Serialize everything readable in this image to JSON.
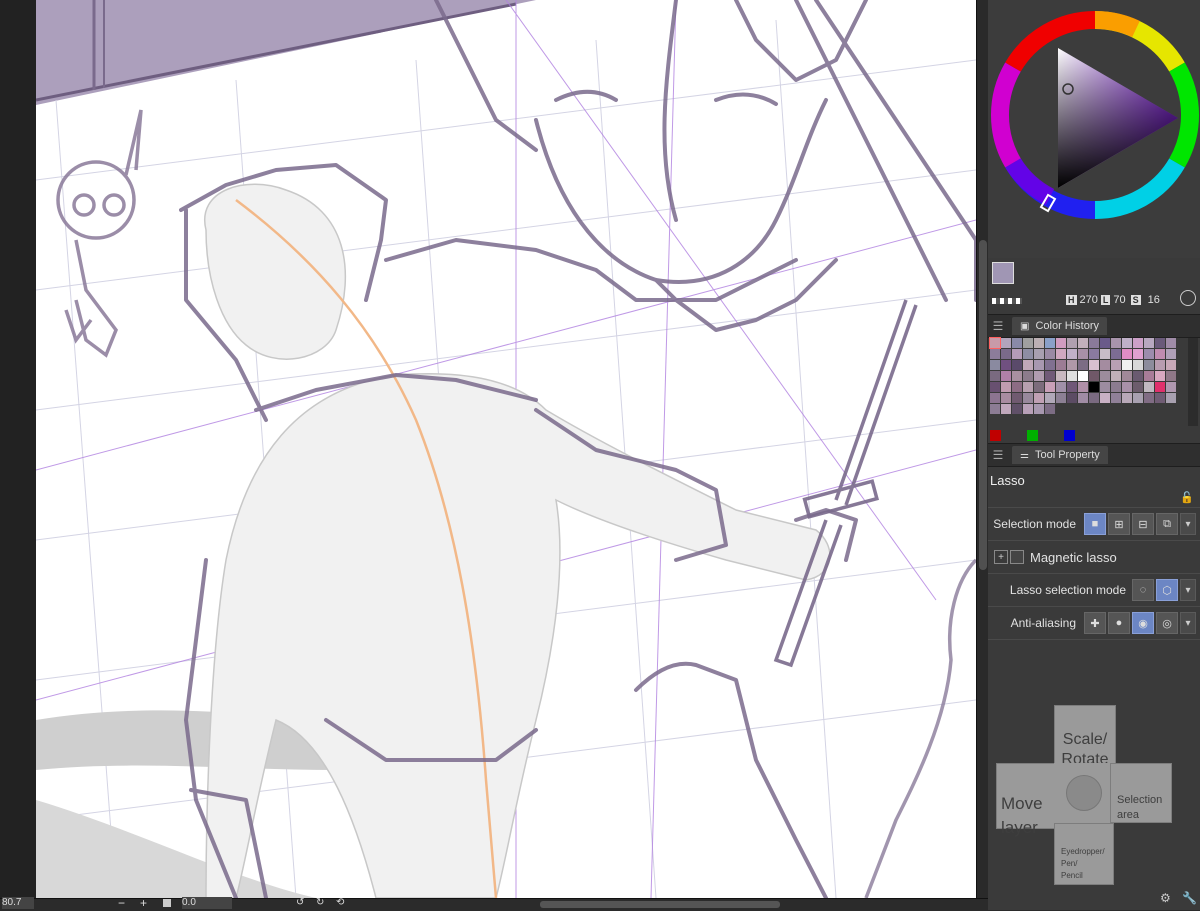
{
  "colors": {
    "main": "#a096b4",
    "sub": "#6a5ad0",
    "accent": "#6c86c4",
    "sketch": "#7a6a8c",
    "ruler": "#a070d8"
  },
  "color_wheel": {
    "h_label": "H",
    "h_value": "270",
    "l_label": "L",
    "l_value": "70",
    "s_label": "S",
    "s_value": "16"
  },
  "color_history": {
    "tab_label": "Color History",
    "swatches": [
      "#c89aa8",
      "#b2a4bc",
      "#8a8aa8",
      "#a0a0a0",
      "#bcb0b4",
      "#8aa0c8",
      "#d09cc0",
      "#b0a0b0",
      "#c2b0bc",
      "#8a7a9a",
      "#6a5a8a",
      "#a894ac",
      "#bfb0c8",
      "#cda0c8",
      "#b8a8c0",
      "#6a5a7a",
      "#a08ca8",
      "#8c7c9a",
      "#7a6a8a",
      "#b49cb8",
      "#8e8ea4",
      "#a8a0b0",
      "#9a8aa4",
      "#d0a8c0",
      "#c0b0c8",
      "#a890a8",
      "#8a7aa0",
      "#c8bcc8",
      "#7c6c94",
      "#e08cc4",
      "#e0a0d0",
      "#9c8cac",
      "#c08cb0",
      "#b0a0b8",
      "#8a8aa0",
      "#705080",
      "#5a4a6a",
      "#c0a8b8",
      "#a898b0",
      "#807090",
      "#9c7c94",
      "#b098a8",
      "#7c6c84",
      "#d8c0d0",
      "#a48ca0",
      "#b8a0b4",
      "#f0f0f0",
      "#d8d8d8",
      "#8c8c9c",
      "#b89cb0",
      "#c8a8b8",
      "#7a6a80",
      "#b080a8",
      "#a890a0",
      "#8c7c8c",
      "#b09cb0",
      "#705a78",
      "#c8b8c0",
      "#e0e0e0",
      "#ffffff",
      "#705868",
      "#9c8c9c",
      "#c0b0b8",
      "#a08898",
      "#6a5a70",
      "#a87c98",
      "#d8a8c0",
      "#907888",
      "#685070",
      "#c09cb0",
      "#8c6c84",
      "#b8a0b0",
      "#7c6c7c",
      "#c8a0b8",
      "#a090a8",
      "#705878",
      "#b090a8",
      "#000000",
      "#9c8ca0",
      "#8c7c90",
      "#a890a8",
      "#6c5c6c",
      "#c0b8c0",
      "#e0306c",
      "#b098b0",
      "#8c7490",
      "#a88ca0",
      "#705a70",
      "#98889c",
      "#c0a0b4",
      "#b0a8b8",
      "#8c8094",
      "#5c4c64",
      "#a08ca4",
      "#7a6a80",
      "#c8b0c4",
      "#908098",
      "#b8a8b8",
      "#a8a0b0",
      "#806c84",
      "#705c74",
      "#a8a0b0",
      "#8c7c94",
      "#c0a8bc",
      "#605068",
      "#b8a0b8",
      "#a898b0",
      "#7c6c84"
    ]
  },
  "tool_property": {
    "tab_label": "Tool Property",
    "tool_name": "Lasso",
    "selection_mode_label": "Selection mode",
    "magnetic_lasso_label": "Magnetic lasso",
    "lasso_selection_mode_label": "Lasso selection mode",
    "anti_aliasing_label": "Anti-aliasing"
  },
  "gamepad": {
    "up_label": "Scale/\nRotate",
    "left_label": "Move\nlayer",
    "right_label": "Selection\narea",
    "down_label": "Eyedropper/\nPen/\nPencil"
  },
  "bottom_bar": {
    "zoom_value": "80.7",
    "minus_label": "−",
    "plus_label": "+",
    "rotation_value": "0.0"
  }
}
